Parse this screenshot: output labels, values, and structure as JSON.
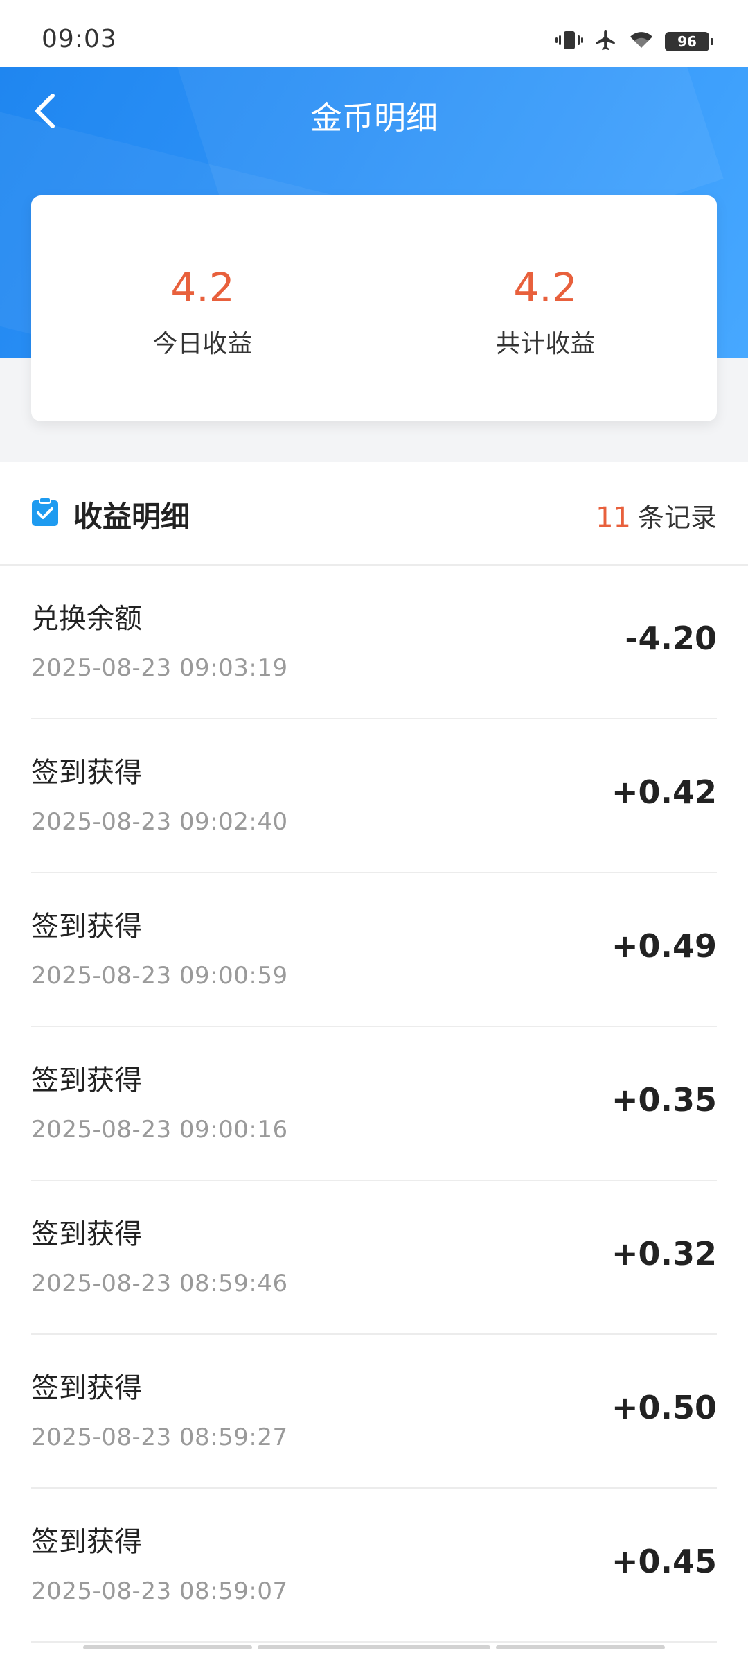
{
  "status_bar": {
    "time": "09:03",
    "battery": "96"
  },
  "header": {
    "title": "金币明细"
  },
  "summary": {
    "today_value": "4.2",
    "today_label": "今日收益",
    "total_value": "4.2",
    "total_label": "共计收益"
  },
  "section": {
    "title": "收益明细",
    "count": "11",
    "count_suffix": "条记录"
  },
  "records": [
    {
      "title": "兑换余额",
      "time": "2025-08-23 09:03:19",
      "amount": "-4.20"
    },
    {
      "title": "签到获得",
      "time": "2025-08-23 09:02:40",
      "amount": "+0.42"
    },
    {
      "title": "签到获得",
      "time": "2025-08-23 09:00:59",
      "amount": "+0.49"
    },
    {
      "title": "签到获得",
      "time": "2025-08-23 09:00:16",
      "amount": "+0.35"
    },
    {
      "title": "签到获得",
      "time": "2025-08-23 08:59:46",
      "amount": "+0.32"
    },
    {
      "title": "签到获得",
      "time": "2025-08-23 08:59:27",
      "amount": "+0.50"
    },
    {
      "title": "签到获得",
      "time": "2025-08-23 08:59:07",
      "amount": "+0.45"
    }
  ],
  "colors": {
    "header_blue": "#2f93f7",
    "accent_orange": "#e8603c",
    "section_icon_blue": "#1e9bf0"
  },
  "icons": [
    "vibrate-icon",
    "airplane-icon",
    "wifi-icon",
    "battery-icon",
    "back-arrow-icon",
    "checklist-icon"
  ]
}
